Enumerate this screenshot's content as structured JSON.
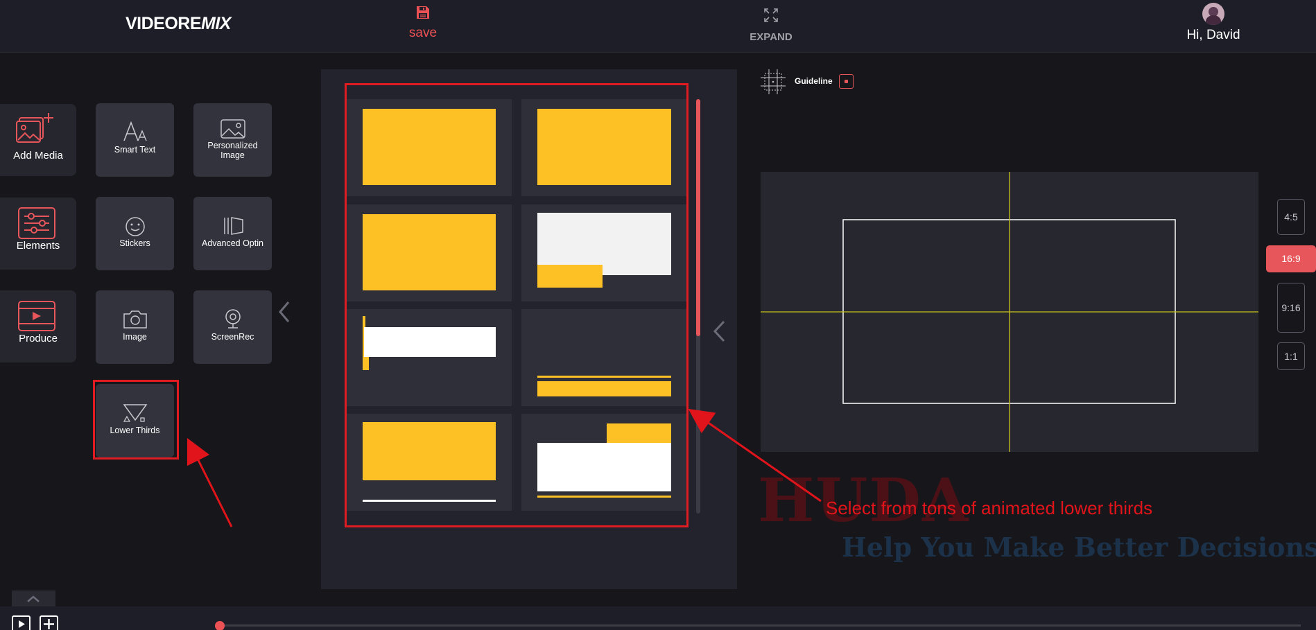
{
  "header": {
    "logo_main": "VIDEORE",
    "logo_mix": "MIX",
    "save_label": "save",
    "expand_label": "EXPAND",
    "greeting": "Hi, David"
  },
  "tools": {
    "add_media": "Add Media",
    "smart_text": "Smart Text",
    "personalized_image_1": "Personalized",
    "personalized_image_2": "Image",
    "elements": "Elements",
    "stickers": "Stickers",
    "advanced_optin": "Advanced Optin",
    "produce": "Produce",
    "image": "Image",
    "screenrec": "ScreenRec",
    "lower_thirds": "Lower Thirds"
  },
  "guideline": {
    "label": "Guideline",
    "enabled": true
  },
  "aspect_ratios": [
    {
      "label": "4:5",
      "active": false
    },
    {
      "label": "16:9",
      "active": true
    },
    {
      "label": "9:16",
      "active": false
    },
    {
      "label": "1:1",
      "active": false
    }
  ],
  "annotation": {
    "text": "Select from tons of animated lower thirds",
    "watermark_brand": "HUDA",
    "watermark_tagline": "Help You Make Better Decisions"
  },
  "colors": {
    "accent": "#ec5255",
    "template_yellow": "#fdc125",
    "annotation_red": "#e2141b",
    "guide_yellow": "#c8c21a"
  }
}
